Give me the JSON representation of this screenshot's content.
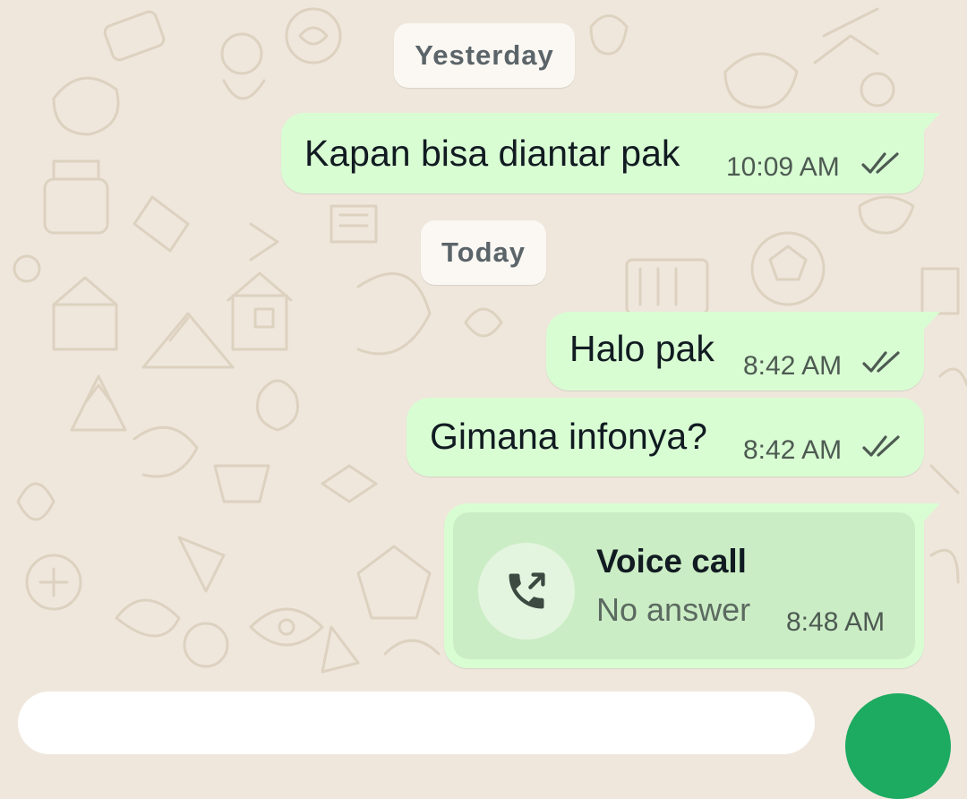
{
  "colors": {
    "outgoing_bubble": "#d9fdd3",
    "voice_call_card": "#cbedc5",
    "chat_background": "#efe7dc",
    "read_ticks": "#4d5a52",
    "send_button": "#1daa61"
  },
  "dates": {
    "yesterday": "Yesterday",
    "today": "Today"
  },
  "messages": [
    {
      "text": "Kapan bisa diantar pak",
      "time": "10:09 AM",
      "status": "read"
    },
    {
      "text": "Halo pak",
      "time": "8:42 AM",
      "status": "read"
    },
    {
      "text": "Gimana infonya?",
      "time": "8:42 AM",
      "status": "read"
    }
  ],
  "voice_call": {
    "icon": "outgoing-call-icon",
    "title": "Voice call",
    "status": "No answer",
    "time": "8:48 AM"
  },
  "input": {
    "placeholder": ""
  }
}
